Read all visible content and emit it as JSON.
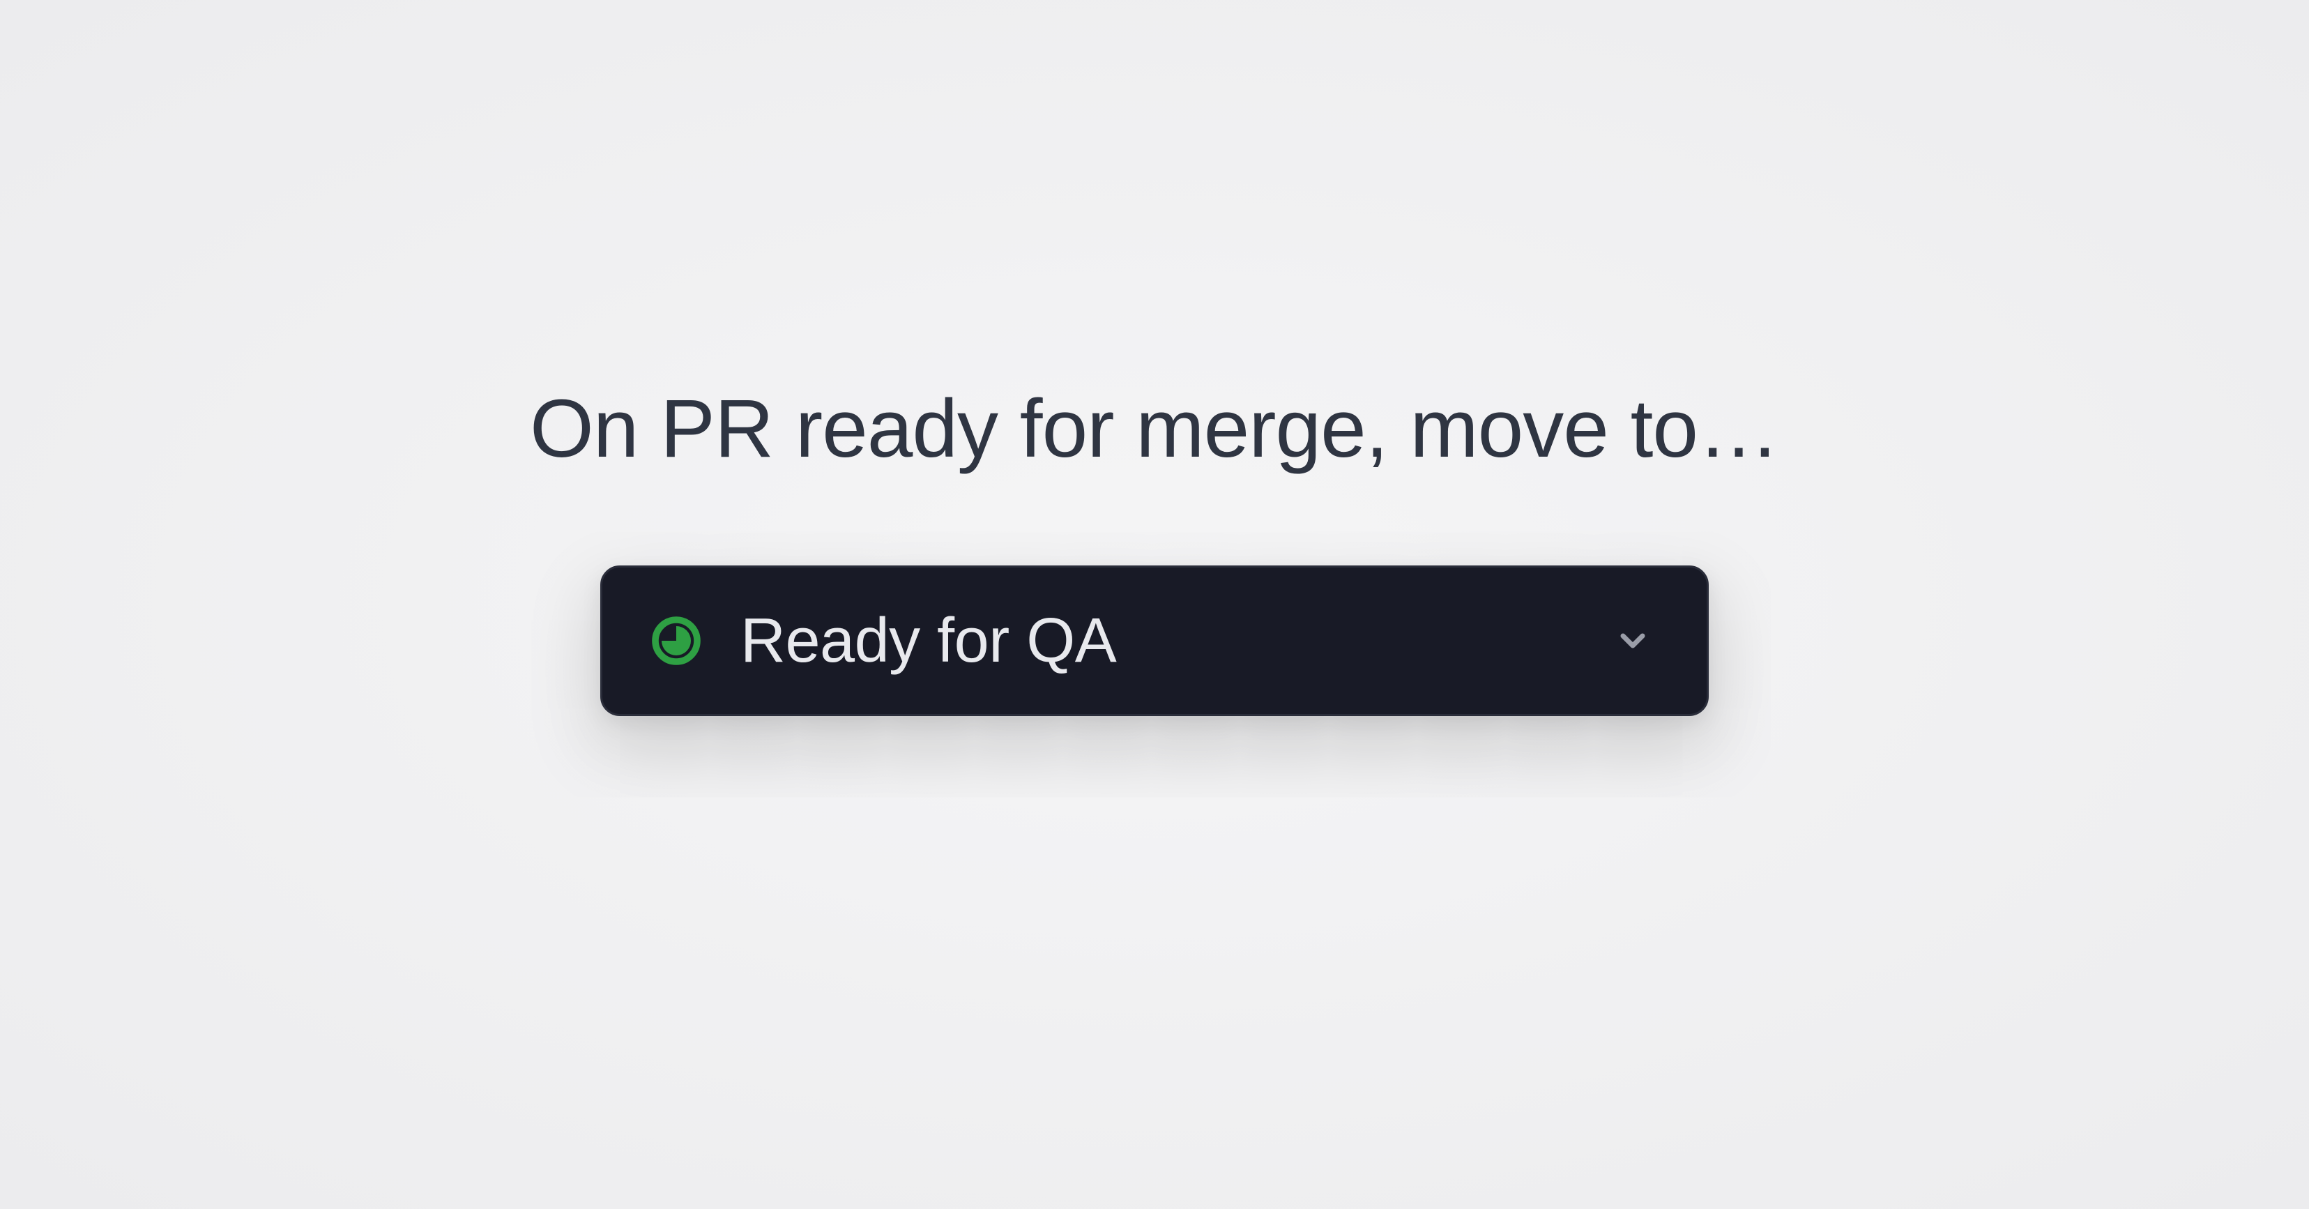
{
  "heading": "On PR ready for merge, move to…",
  "select": {
    "selected_label": "Ready for QA",
    "status_icon_name": "three-quarter-circle-icon",
    "status_color": "#2ea043"
  }
}
